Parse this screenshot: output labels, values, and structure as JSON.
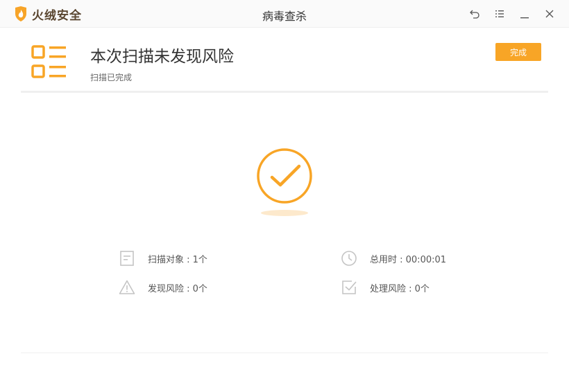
{
  "app": {
    "brand": "火绒安全",
    "window_title": "病毒查杀",
    "logo_icon": "flame-shield-icon"
  },
  "window_controls": [
    {
      "name": "back-icon"
    },
    {
      "name": "menu-icon"
    },
    {
      "name": "minimize-icon"
    },
    {
      "name": "close-icon"
    }
  ],
  "header": {
    "title": "本次扫描未发现风险",
    "subtitle": "扫描已完成",
    "done_label": "完成",
    "icon": "checklist-icon"
  },
  "result": {
    "icon": "check-circle-icon"
  },
  "stats": {
    "scan_objects": "扫描对象 : 1个",
    "total_time": "总用时 : 00:00:01",
    "risks_found": "发现风险 : 0个",
    "risks_handled": "处理风险 : 0个"
  },
  "colors": {
    "accent": "#f8a526",
    "icon_gray": "#c4c4c4",
    "titlebar_bg": "#fafafa",
    "brand_text": "#5a4630"
  }
}
